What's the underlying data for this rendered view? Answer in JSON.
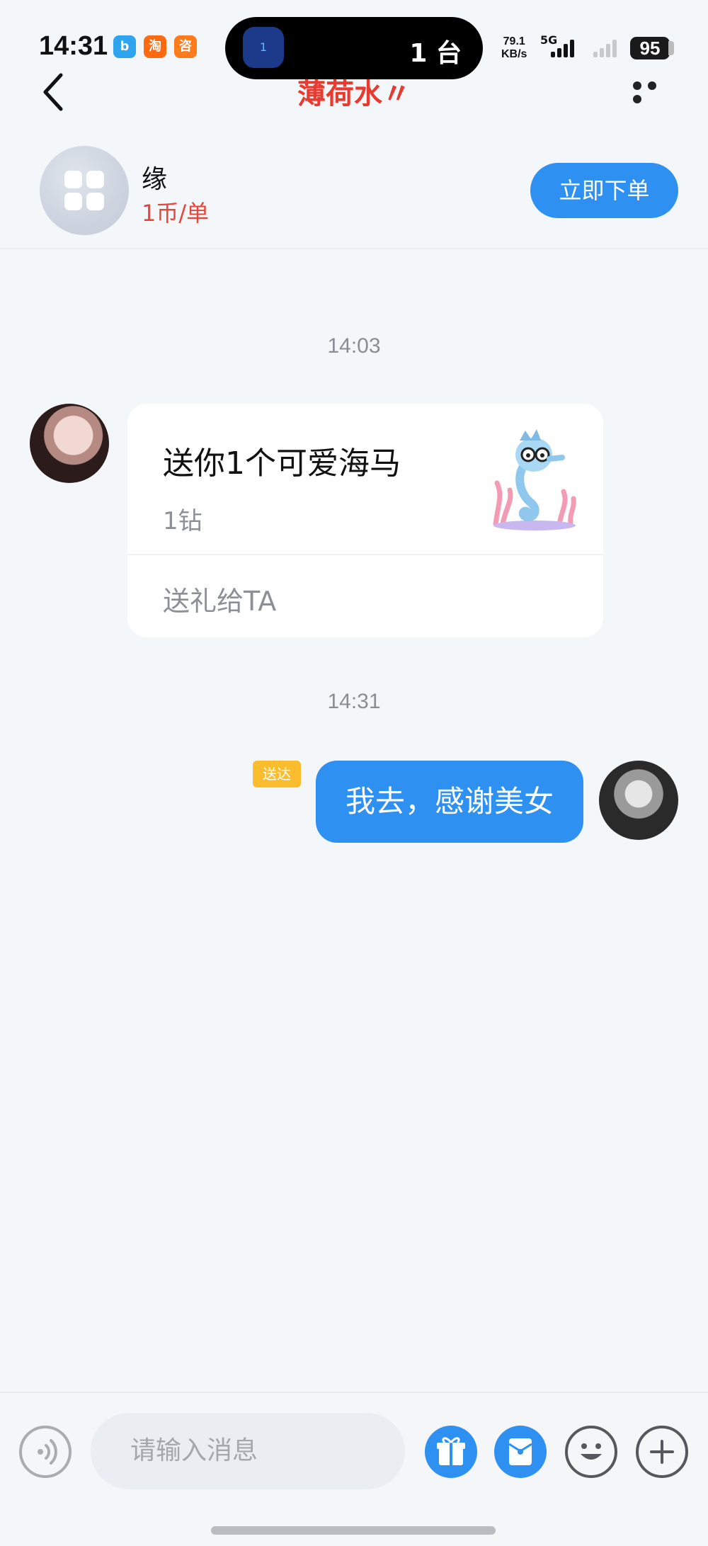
{
  "status_bar": {
    "time": "14:31",
    "apps": [
      "b",
      "淘",
      "咨"
    ],
    "island_text": "1 台",
    "island_badge": "1",
    "net_speed_value": "79.1",
    "net_speed_unit": "KB/s",
    "network": "5G",
    "battery": "95"
  },
  "nav": {
    "title": "薄荷水〃"
  },
  "service": {
    "name": "缘",
    "price": "1币/单",
    "order_label": "立即下单"
  },
  "chat": {
    "messages": [
      {
        "time": "14:03",
        "type": "gift",
        "gift_title": "送你1个可爱海马",
        "gift_price": "1钻",
        "action": "送礼给TA"
      },
      {
        "time": "14:31",
        "type": "text",
        "status": "送达",
        "text": "我去，感谢美女"
      }
    ]
  },
  "input": {
    "placeholder": "请输入消息"
  },
  "colors": {
    "accent": "#2e90f0",
    "title_red": "#e83a2e",
    "price_red": "#e8463b",
    "badge_yellow": "#fbbd2e",
    "background": "#f4f7fa"
  }
}
